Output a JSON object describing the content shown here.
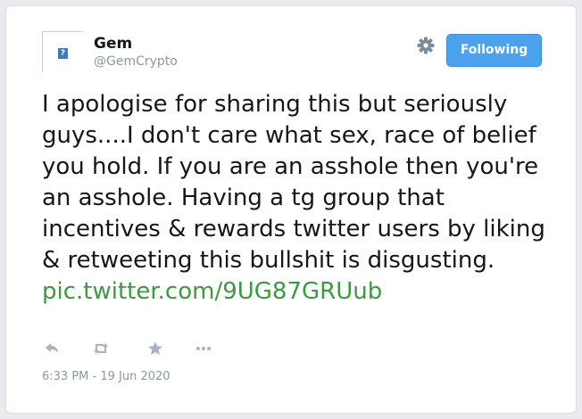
{
  "user": {
    "name": "Gem",
    "handle": "@GemCrypto",
    "avatar_icon": "broken-image-icon"
  },
  "header": {
    "settings_icon": "gear-icon",
    "follow_button_label": "Following",
    "follow_button_color": "#4aa3ec"
  },
  "tweet": {
    "text": "I apologise for sharing this but seriously guys....I don't care what sex, race of belief you hold. If you are an asshole then you're an asshole. Having a tg group that incentives & rewards twitter users by liking & retweeting this bullshit is disgusting.",
    "link": "pic.twitter.com/9UG87GRUub",
    "link_color": "#3c9a3f",
    "timestamp": "6:33 PM - 19 Jun 2020"
  },
  "actions": [
    {
      "icon": "reply-icon"
    },
    {
      "icon": "retweet-icon"
    },
    {
      "icon": "star-icon"
    },
    {
      "icon": "more-icon"
    }
  ]
}
